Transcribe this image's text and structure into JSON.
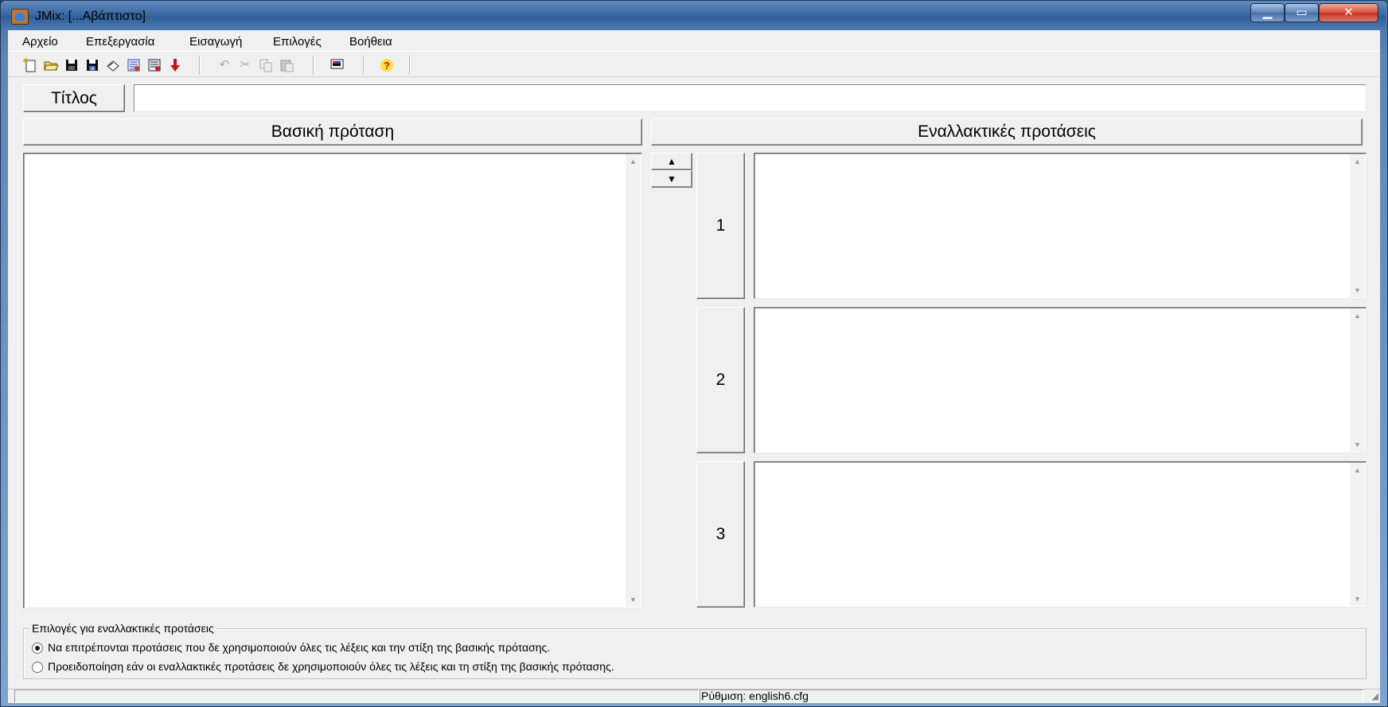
{
  "window": {
    "title": "JMix: [...Αβάπτιστο]",
    "minimize_glyph": "▁",
    "maximize_glyph": "▭",
    "close_glyph": "✕"
  },
  "menu": {
    "items": [
      "Αρχείο",
      "Επεξεργασία",
      "Εισαγωγή",
      "Επιλογές",
      "Βοήθεια"
    ]
  },
  "toolbar": {
    "icons": {
      "new": "new-file-icon",
      "open": "open-folder-icon",
      "save": "save-icon",
      "save_as": "save-as-icon",
      "eraser": "eraser-icon",
      "web_page": "web-page-icon",
      "drag_drop": "drag-drop-page-icon",
      "export": "down-arrow-icon",
      "undo": "undo-icon",
      "cut": "cut-icon",
      "copy": "copy-icon",
      "paste": "paste-icon",
      "config": "config-icon",
      "help": "help-icon"
    }
  },
  "form": {
    "title_label": "Τίτλος",
    "title_value": "",
    "main_header": "Βασική πρόταση",
    "alt_header": "Εναλλακτικές προτάσεις",
    "main_text": "",
    "alternatives": [
      {
        "number": "1",
        "text": ""
      },
      {
        "number": "2",
        "text": ""
      },
      {
        "number": "3",
        "text": ""
      }
    ],
    "up_glyph": "▲",
    "down_glyph": "▼"
  },
  "options": {
    "legend": "Επιλογές για εναλλακτικές προτάσεις",
    "radio_1": "Να επιτρέπονται προτάσεις που δε χρησιμοποιούν όλες τις λέξεις και την στίξη της βασικής πρότασης.",
    "radio_2": "Προειδοποίηση εάν οι εναλλακτικές προτάσεις δε χρησιμοποιούν όλες τις λέξεις και τη στίξη της βασικής πρότασης.",
    "selected": 1
  },
  "status": {
    "left": "",
    "config": "Ρύθμιση: english6.cfg"
  }
}
